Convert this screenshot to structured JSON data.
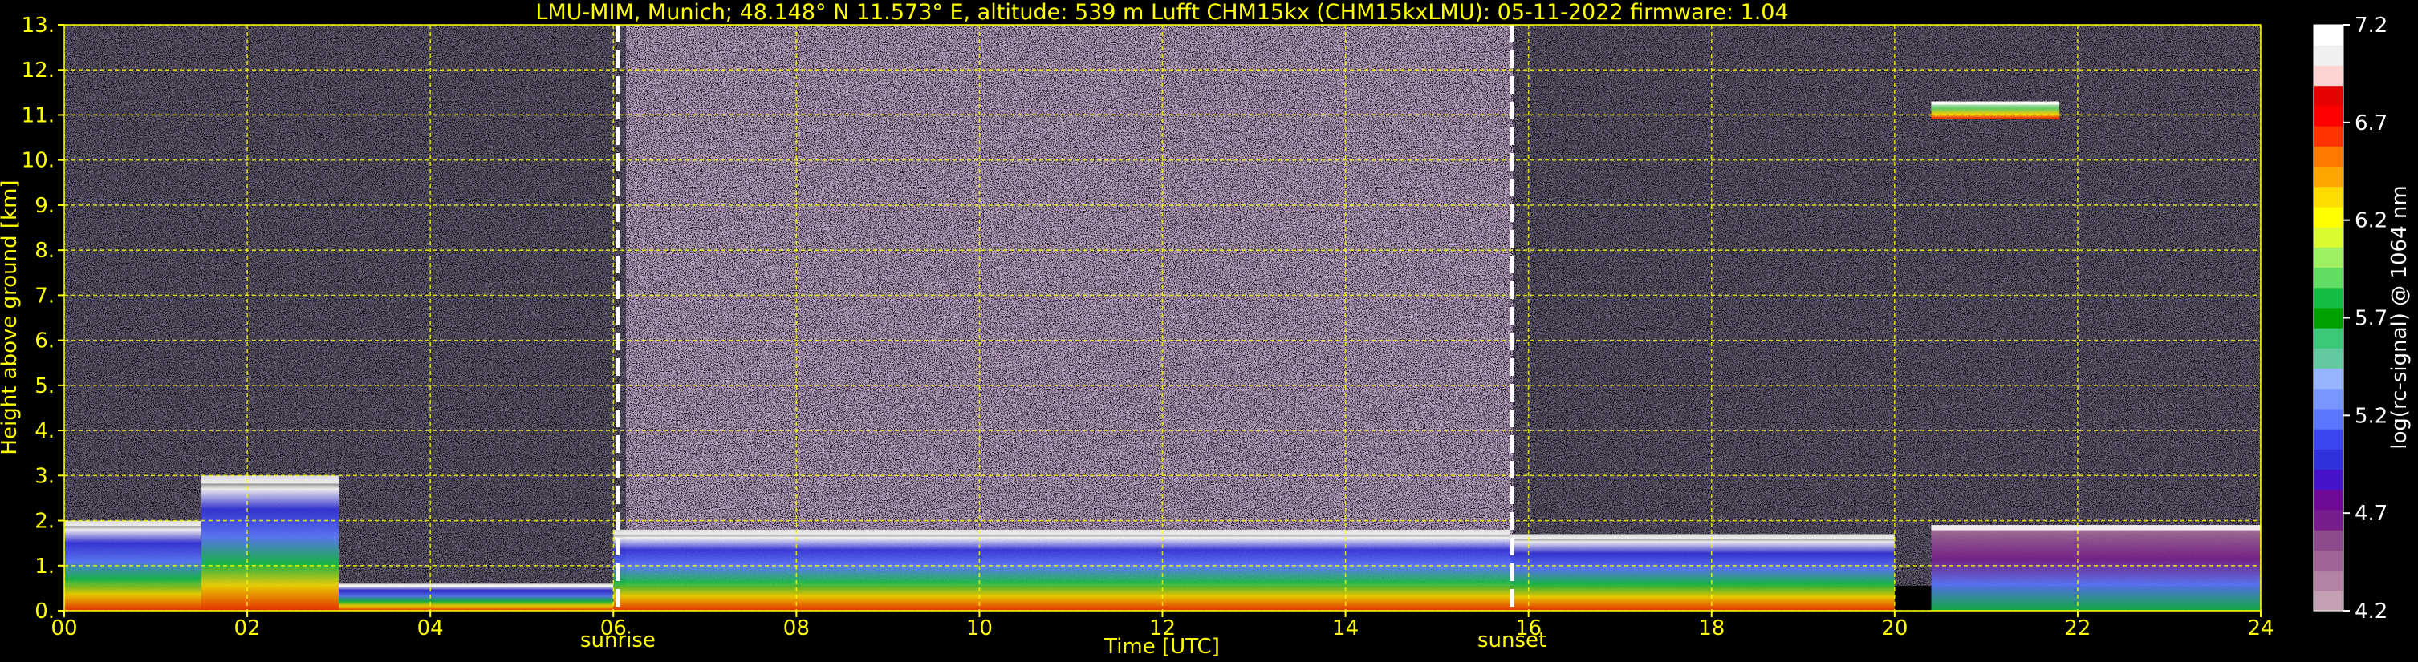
{
  "header": {
    "title": "LMU-MIM, Munich; 48.148° N 11.573° E, altitude: 539 m    Lufft CHM15kx (CHM15kxLMU): 05-11-2022    firmware: 1.04"
  },
  "chart_data": {
    "type": "heatmap",
    "title": "LMU-MIM, Munich; 48.148° N 11.573° E, altitude: 539 m    Lufft CHM15kx (CHM15kxLMU): 05-11-2022    firmware: 1.04",
    "xlabel": "Time [UTC]",
    "ylabel": "Height above ground [km]",
    "xlim": [
      0,
      24
    ],
    "ylim": [
      0,
      13
    ],
    "x_ticks": [
      "00",
      "02",
      "04",
      "06",
      "08",
      "10",
      "12",
      "14",
      "16",
      "18",
      "20",
      "22",
      "24"
    ],
    "y_ticks": [
      "0.",
      "1.",
      "2.",
      "3.",
      "4.",
      "5.",
      "6.",
      "7.",
      "8.",
      "9.",
      "10.",
      "11.",
      "12.",
      "13."
    ],
    "grid": true,
    "grid_color": "#ffff00",
    "annotations": [
      {
        "label": "sunrise",
        "x": 6.05
      },
      {
        "label": "sunset",
        "x": 15.82
      }
    ],
    "colorbar": {
      "label": "log(rc-signal) @ 1064 nm",
      "range": [
        4.2,
        7.2
      ],
      "ticks": [
        "4.2",
        "4.7",
        "5.2",
        "5.7",
        "6.2",
        "6.7",
        "7.2"
      ],
      "colors": [
        "#c3a0b4",
        "#b482a5",
        "#a06496",
        "#8c4b8c",
        "#781e8c",
        "#6e0a96",
        "#4614c8",
        "#3232dc",
        "#3c46f0",
        "#5a78ff",
        "#7896ff",
        "#96b4ff",
        "#64c8a0",
        "#3cc878",
        "#00a000",
        "#14be46",
        "#64dc64",
        "#a0f064",
        "#dcfa32",
        "#ffff00",
        "#ffdc00",
        "#ffa500",
        "#ff7800",
        "#ff3200",
        "#ff0000",
        "#e60000",
        "#ffd2d2",
        "#f0f0f0",
        "#ffffff"
      ]
    },
    "data_description_layers": [
      {
        "t_start": 0.0,
        "t_end": 1.5,
        "h_base": 0.0,
        "h_top": 2.0
      },
      {
        "t_start": 1.5,
        "t_end": 3.0,
        "h_base": 0.0,
        "h_top": 3.0
      },
      {
        "t_start": 3.0,
        "t_end": 6.0,
        "h_base": 0.0,
        "h_top": 0.6
      },
      {
        "t_start": 6.0,
        "t_end": 15.8,
        "h_base": 0.0,
        "h_top": 1.8
      },
      {
        "t_start": 15.8,
        "t_end": 20.0,
        "h_base": 0.0,
        "h_top": 1.7
      },
      {
        "t_start": 20.4,
        "t_end": 24.0,
        "h_base": 0.0,
        "h_top": 1.9
      },
      {
        "t_start": 20.4,
        "t_end": 21.8,
        "h_base": 10.9,
        "h_top": 11.3
      }
    ]
  }
}
